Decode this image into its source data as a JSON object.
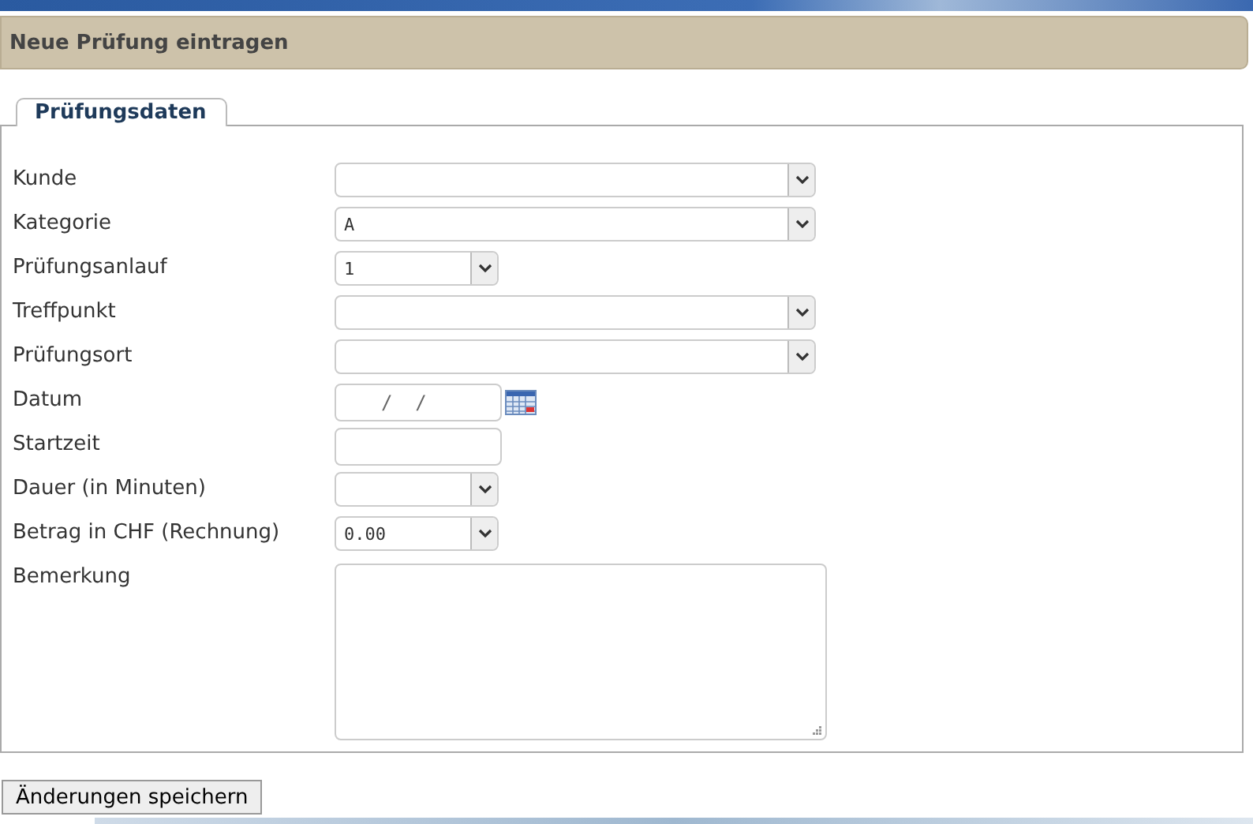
{
  "header": {
    "title": "Neue Prüfung eintragen"
  },
  "tabs": [
    {
      "label": "Prüfungsdaten",
      "selected": true
    }
  ],
  "fields": [
    {
      "label": "Kunde",
      "kind": "select_wide"
    },
    {
      "label": "Kategorie",
      "kind": "select_wide",
      "value": "A"
    },
    {
      "label": "Prüfungsanlauf",
      "kind": "select_narrow",
      "value": "1"
    },
    {
      "label": "Treffpunkt",
      "kind": "select_wide"
    },
    {
      "label": "Prüfungsort",
      "kind": "select_wide"
    },
    {
      "label": "Datum",
      "kind": "date",
      "value": "  /  /"
    },
    {
      "label": "Startzeit",
      "kind": "text"
    },
    {
      "label": "Dauer (in Minuten)",
      "kind": "select_narrow"
    },
    {
      "label": "Betrag in CHF (Rechnung)",
      "kind": "select_narrow",
      "value": "0.00"
    },
    {
      "label": "Bemerkung",
      "kind": "textarea"
    }
  ],
  "save_button": "Änderungen speichern"
}
